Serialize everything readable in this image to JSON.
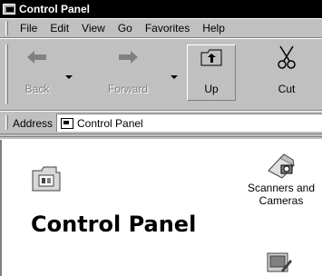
{
  "window": {
    "title": "Control Panel"
  },
  "menu": [
    "File",
    "Edit",
    "View",
    "Go",
    "Favorites",
    "Help"
  ],
  "toolbar": {
    "back_label": "Back",
    "forward_label": "Forward",
    "up_label": "Up",
    "cut_label": "Cut"
  },
  "address": {
    "label": "Address",
    "value": "Control Panel"
  },
  "content": {
    "title": "Control Panel",
    "items": [
      {
        "label": "Scanners and Cameras",
        "icon": "scanner-camera-icon"
      },
      {
        "label": "",
        "icon": "control-panel-item-icon"
      }
    ]
  },
  "colors": {
    "titlebar": "#000000",
    "chrome": "#c0c0c0",
    "content": "#ffffff"
  }
}
